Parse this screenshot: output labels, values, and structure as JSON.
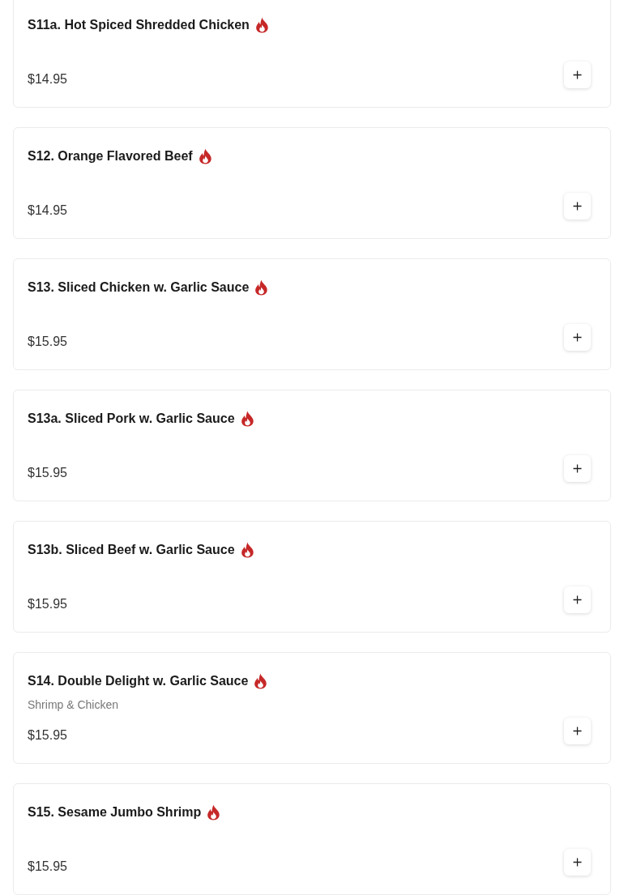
{
  "items": [
    {
      "name": "S11a. Hot Spiced Shredded Chicken",
      "spicy": true,
      "price": "$14.95"
    },
    {
      "name": "S12. Orange Flavored Beef",
      "spicy": true,
      "price": "$14.95"
    },
    {
      "name": "S13. Sliced Chicken w. Garlic Sauce",
      "spicy": true,
      "price": "$15.95"
    },
    {
      "name": "S13a. Sliced Pork w. Garlic Sauce",
      "spicy": true,
      "price": "$15.95"
    },
    {
      "name": "S13b. Sliced Beef w. Garlic Sauce",
      "spicy": true,
      "price": "$15.95"
    },
    {
      "name": "S14. Double Delight w. Garlic Sauce",
      "spicy": true,
      "description": "Shrimp & Chicken",
      "price": "$15.95"
    },
    {
      "name": "S15. Sesame Jumbo Shrimp",
      "spicy": true,
      "price": "$15.95"
    }
  ]
}
